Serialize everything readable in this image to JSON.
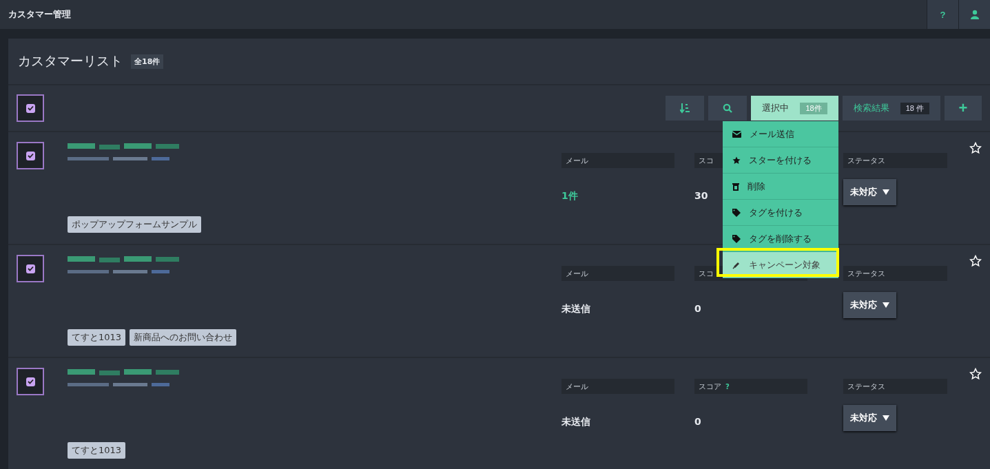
{
  "app": {
    "title": "カスタマー管理",
    "help": "?"
  },
  "list": {
    "title": "カスタマーリスト",
    "count": "全18件",
    "all_checked": true
  },
  "toolbar": {
    "tabs": [
      {
        "label": "選択中",
        "count": "18件",
        "selected": true
      },
      {
        "label": "検索結果",
        "count": "18 件",
        "selected": false
      }
    ],
    "add": "+"
  },
  "menu": [
    {
      "kind": "mail",
      "label": "メール送信",
      "highlighted": false
    },
    {
      "kind": "star",
      "label": "スターを付ける",
      "highlighted": false
    },
    {
      "kind": "trash",
      "label": "削除",
      "highlighted": false
    },
    {
      "kind": "tag",
      "label": "タグを付ける",
      "highlighted": false
    },
    {
      "kind": "tag",
      "label": "タグを削除する",
      "highlighted": false
    },
    {
      "kind": "campaign",
      "label": "キャンペーン対象",
      "highlighted": true
    }
  ],
  "customers": [
    {
      "checked": true,
      "tags": [
        "ポップアップフォームサンプル"
      ],
      "mail_label": "メール",
      "score_label": "スコ",
      "status_label": "ステータス",
      "mail_value": "1件",
      "mail_link": true,
      "score": "30",
      "status": "未対応",
      "starred": false
    },
    {
      "checked": true,
      "tags": [
        "てすと1013",
        "新商品へのお問い合わせ"
      ],
      "mail_label": "メール",
      "score_label": "スコ",
      "status_label": "ステータス",
      "mail_value": "未送信",
      "mail_link": false,
      "score": "0",
      "status": "未対応",
      "starred": false
    },
    {
      "checked": true,
      "tags": [
        "てすと1013"
      ],
      "mail_label": "メール",
      "score_label": "スコア",
      "score_help": true,
      "status_label": "ステータス",
      "mail_value": "未送信",
      "mail_link": false,
      "score": "0",
      "status": "未対応",
      "starred": false
    }
  ]
}
